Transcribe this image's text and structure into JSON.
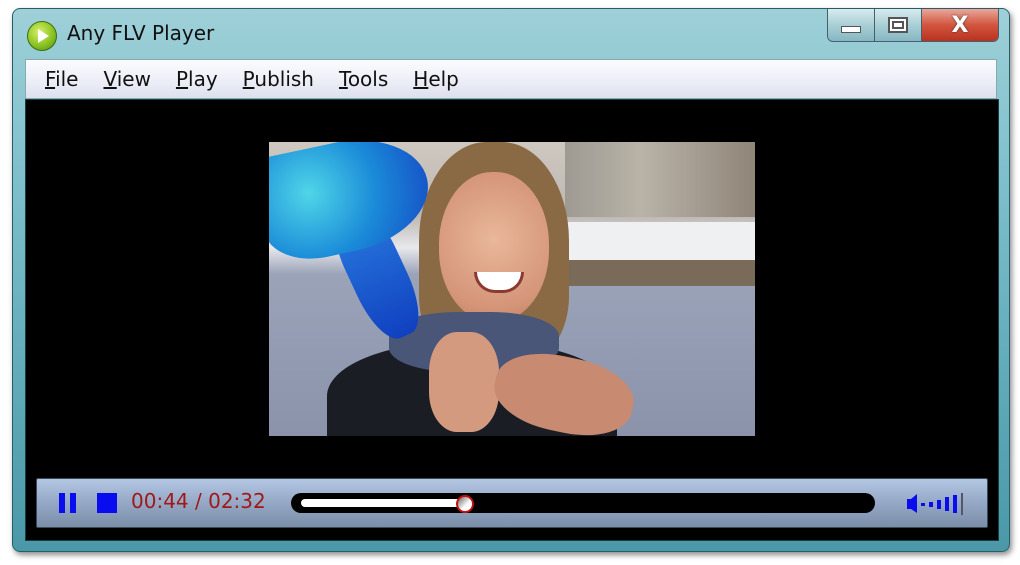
{
  "window": {
    "title": "Any FLV Player",
    "icon": "play-logo-icon",
    "caption_buttons": {
      "minimize_icon": "minimize-icon",
      "maximize_icon": "maximize-icon",
      "close_icon": "close-icon",
      "close_glyph": "X"
    }
  },
  "menu": {
    "items": [
      {
        "accel": "F",
        "rest": "ile"
      },
      {
        "accel": "V",
        "rest": "iew"
      },
      {
        "accel": "P",
        "rest": "lay"
      },
      {
        "accel": "P",
        "rest": "ublish"
      },
      {
        "accel": "T",
        "rest": "ools"
      },
      {
        "accel": "H",
        "rest": "elp"
      }
    ]
  },
  "player": {
    "video_content": "woman smiling by river holding blue balloon",
    "state": "playing",
    "pause_icon": "pause-icon",
    "stop_icon": "stop-icon",
    "elapsed": "00:44",
    "separator": " / ",
    "duration": "02:32",
    "progress_fraction": 0.29,
    "volume_icon": "volume-icon",
    "colors": {
      "control_blue": "#0a0cf0",
      "time_red": "#a01818",
      "thumb_red": "#c01010"
    }
  }
}
